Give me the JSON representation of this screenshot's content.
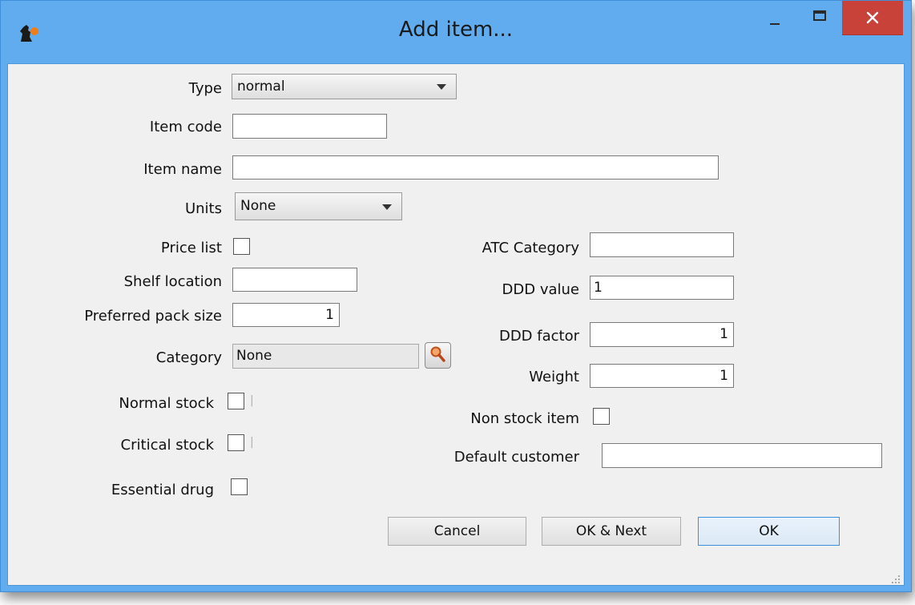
{
  "window": {
    "title": "Add item..."
  },
  "icons": {
    "app": "app-logo-icon",
    "minimize": "minimize-icon",
    "maximize": "maximize-icon",
    "close": "close-icon",
    "lookup": "search-icon",
    "dropdown": "chevron-down-icon"
  },
  "colors": {
    "titlebar": "#60acee",
    "close_button": "#c9423a",
    "client_background": "#f0f0f0",
    "default_button_border": "#3c8fdc"
  },
  "form": {
    "type": {
      "label": "Type",
      "value": "normal"
    },
    "item_code": {
      "label": "Item code",
      "value": ""
    },
    "item_name": {
      "label": "Item name",
      "value": ""
    },
    "units": {
      "label": "Units",
      "value": "None"
    },
    "price_list": {
      "label": "Price list",
      "checked": false
    },
    "shelf_location": {
      "label": "Shelf location",
      "value": ""
    },
    "preferred_pack_size": {
      "label": "Preferred pack size",
      "value": "1"
    },
    "category": {
      "label": "Category",
      "value": "None"
    },
    "normal_stock": {
      "label": "Normal stock",
      "checked": false
    },
    "critical_stock": {
      "label": "Critical stock",
      "checked": false
    },
    "essential_drug": {
      "label": "Essential drug",
      "checked": false
    },
    "atc_category": {
      "label": "ATC Category",
      "value": ""
    },
    "ddd_value": {
      "label": "DDD value",
      "value": "1"
    },
    "ddd_factor": {
      "label": "DDD factor",
      "value": "1"
    },
    "weight": {
      "label": "Weight",
      "value": "1"
    },
    "non_stock_item": {
      "label": "Non stock item",
      "checked": false
    },
    "default_customer": {
      "label": "Default customer",
      "value": ""
    }
  },
  "buttons": {
    "cancel": "Cancel",
    "ok_next": "OK & Next",
    "ok": "OK"
  }
}
